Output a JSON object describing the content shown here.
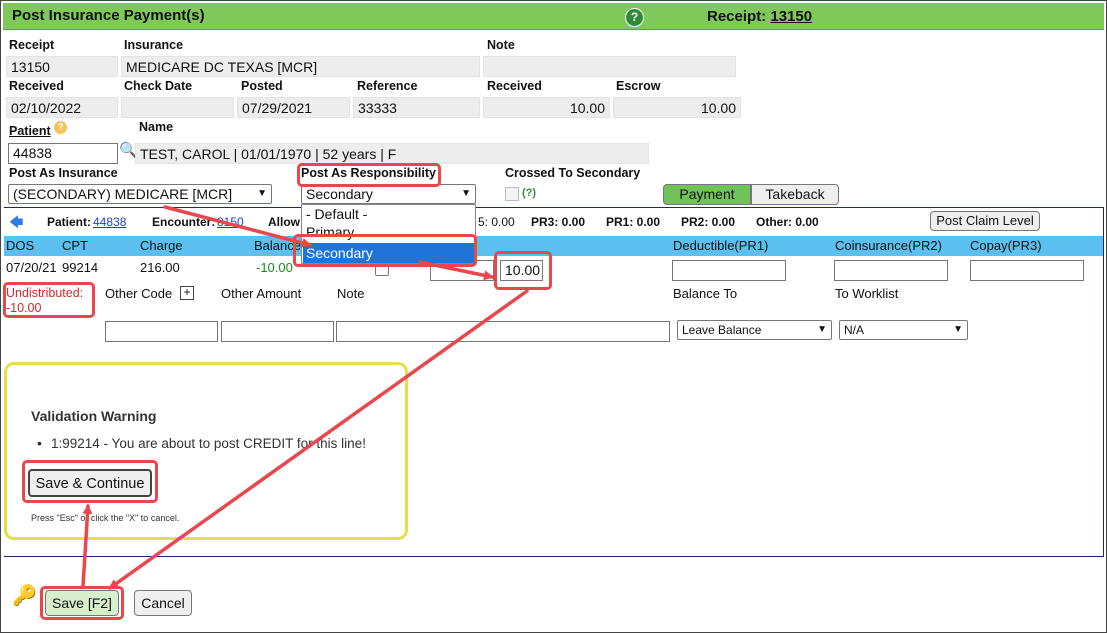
{
  "header": {
    "title": "Post Insurance Payment(s)",
    "help_glyph": "?",
    "receipt_label": "Receipt:",
    "receipt_number": "13150"
  },
  "fields": {
    "receipt_label": "Receipt",
    "receipt_value": "13150",
    "insurance_label": "Insurance",
    "insurance_value": "MEDICARE DC TEXAS [MCR]",
    "note_label": "Note",
    "note_value": "",
    "received_label": "Received",
    "received_value": "02/10/2022",
    "check_date_label": "Check Date",
    "check_date_value": "",
    "posted_label": "Posted",
    "posted_value": "07/29/2021",
    "reference_label": "Reference",
    "reference_value": "33333",
    "received_amt_label": "Received",
    "received_amt_value": "10.00",
    "escrow_label": "Escrow",
    "escrow_value": "10.00",
    "patient_label": "Patient",
    "patient_id": "44838",
    "name_label": "Name",
    "name_value": "TEST, CAROL | 01/01/1970 | 52 years | F",
    "post_as_insurance_label": "Post As Insurance",
    "post_as_insurance_value": "(SECONDARY) MEDICARE [MCR]",
    "post_as_responsibility_label": "Post As Responsibility",
    "post_as_responsibility_value": "Secondary",
    "crossed_label": "Crossed To Secondary",
    "crossed_help": "(?)"
  },
  "responsibility_options": [
    "- Default -",
    "Primary",
    "Secondary"
  ],
  "mode_tabs": {
    "payment": "Payment",
    "takeback": "Takeback"
  },
  "summary": {
    "arrow_glyph": "🡄",
    "patient_label": "Patient:",
    "patient_link": "44838",
    "encounter_label": "Encounter:",
    "encounter_link": "8150",
    "allowed_label": "Allow",
    "pr_partial": "5: 0.00",
    "pr3": "PR3: 0.00",
    "pr1": "PR1: 0.00",
    "pr2": "PR2: 0.00",
    "other": "Other: 0.00",
    "post_claim_level": "Post Claim Level"
  },
  "table": {
    "headers": [
      "DOS",
      "CPT",
      "Charge",
      "Balance",
      "Deductible(PR1)",
      "Coinsurance(PR2)",
      "Copay(PR3)"
    ],
    "row": {
      "dos": "07/20/21",
      "cpt": "99214",
      "charge": "216.00",
      "balance": "-10.00",
      "payment": "10.00"
    }
  },
  "line": {
    "undistributed_label": "Undistributed:",
    "undistributed_value": "-10.00",
    "other_code_label": "Other Code",
    "plus_glyph": "+",
    "other_amount_label": "Other Amount",
    "note_label": "Note",
    "balance_to_label": "Balance To",
    "balance_to_value": "Leave Balance",
    "worklist_label": "To Worklist",
    "worklist_value": "N/A"
  },
  "warning": {
    "title": "Validation Warning",
    "message": "1:99214 - You are about to post CREDIT for this line!",
    "save_continue": "Save & Continue",
    "hint": "Press \"Esc\" or click the \"X\" to cancel."
  },
  "footer": {
    "save": "Save [F2]",
    "cancel": "Cancel"
  },
  "colors": {
    "title_bar": "#7ec95a",
    "table_header": "#5bc0f0",
    "highlight": "#e8474c",
    "warning_border": "#e5e04a"
  }
}
